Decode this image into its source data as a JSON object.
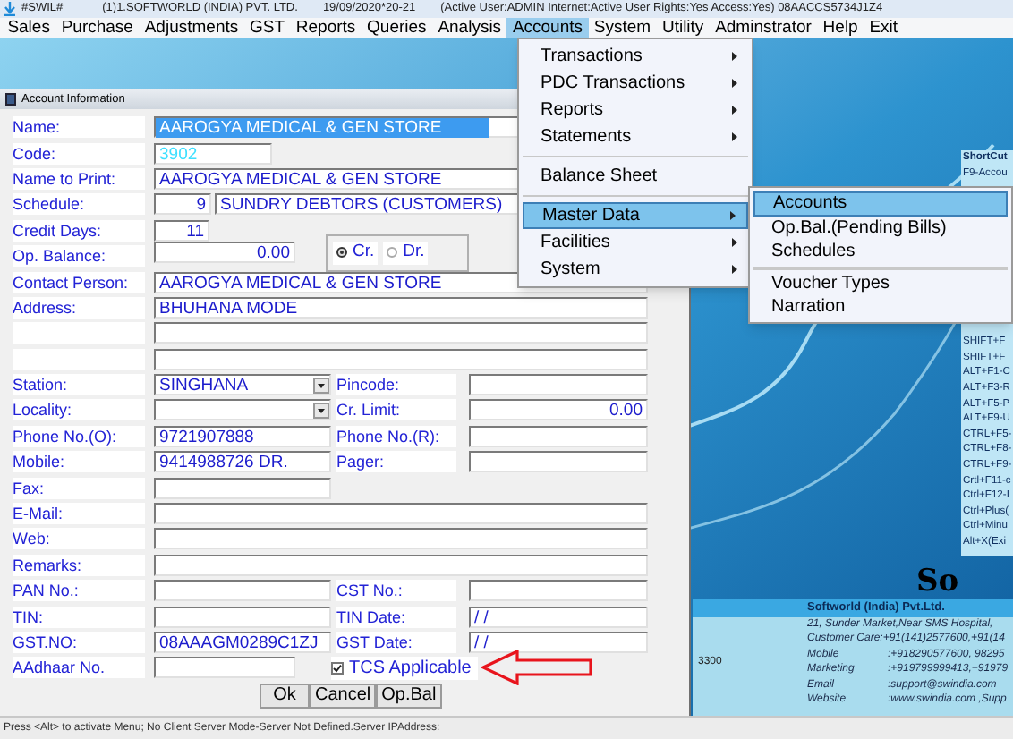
{
  "title_bar": {
    "app": "#SWIL#",
    "company": "(1)1.SOFTWORLD (INDIA) PVT. LTD.",
    "date": "19/09/2020*20-21",
    "session": "(Active User:ADMIN Internet:Active  User Rights:Yes Access:Yes) 08AACCS5734J1Z4"
  },
  "menu_bar": [
    {
      "label": "Sales",
      "selected": false
    },
    {
      "label": "Purchase",
      "selected": false
    },
    {
      "label": "Adjustments",
      "selected": false
    },
    {
      "label": "GST",
      "selected": false
    },
    {
      "label": "Reports",
      "selected": false
    },
    {
      "label": "Queries",
      "selected": false
    },
    {
      "label": "Analysis",
      "selected": false
    },
    {
      "label": "Accounts",
      "selected": true
    },
    {
      "label": "System",
      "selected": false
    },
    {
      "label": "Utility",
      "selected": false
    },
    {
      "label": "Adminstrator",
      "selected": false
    },
    {
      "label": "Help",
      "selected": false
    },
    {
      "label": "Exit",
      "selected": false
    }
  ],
  "accounts_menu": [
    {
      "label": "Transactions",
      "submenu": true,
      "separator_before": false,
      "selected": false
    },
    {
      "label": "PDC Transactions",
      "submenu": true,
      "separator_before": false,
      "selected": false
    },
    {
      "label": "Reports",
      "submenu": true,
      "separator_before": false,
      "selected": false
    },
    {
      "label": "Statements",
      "submenu": true,
      "separator_before": false,
      "selected": false
    },
    {
      "label": "Balance Sheet",
      "submenu": false,
      "separator_before": true,
      "selected": false
    },
    {
      "label": "Master Data",
      "submenu": true,
      "separator_before": true,
      "selected": true
    },
    {
      "label": "Facilities",
      "submenu": true,
      "separator_before": false,
      "selected": false
    },
    {
      "label": "System",
      "submenu": true,
      "separator_before": false,
      "selected": false
    }
  ],
  "master_data_submenu": [
    {
      "label": "Accounts",
      "separator_before": false,
      "selected": true
    },
    {
      "label": "Op.Bal.(Pending Bills)",
      "separator_before": false,
      "selected": false
    },
    {
      "label": "Schedules",
      "separator_before": false,
      "selected": false
    },
    {
      "label": "Voucher Types",
      "separator_before": true,
      "selected": false
    },
    {
      "label": "Narration",
      "separator_before": false,
      "selected": false
    }
  ],
  "account_form": {
    "title": "Account Information",
    "rows": [
      {
        "kind": "selected_text",
        "label": "Name:",
        "value": "AAROGYA MEDICAL & GEN STORE"
      },
      {
        "kind": "code",
        "label": "Code:",
        "value": "3902"
      },
      {
        "kind": "wide",
        "label": "Name to Print:",
        "value": "AAROGYA MEDICAL & GEN STORE"
      },
      {
        "kind": "schedule",
        "label": "Schedule:",
        "number": "9",
        "value": "SUNDRY DEBTORS (CUSTOMERS)"
      },
      {
        "kind": "number",
        "label": "Credit Days:",
        "value": "11"
      },
      {
        "kind": "balance",
        "label": "Op. Balance:",
        "value": "0.00",
        "options": [
          {
            "label": "Cr.",
            "selected": true
          },
          {
            "label": "Dr.",
            "selected": false
          }
        ]
      },
      {
        "kind": "wide",
        "label": "Contact Person:",
        "value": "AAROGYA MEDICAL & GEN STORE"
      },
      {
        "kind": "wide",
        "label": "Address:",
        "value": "BHUHANA MODE"
      },
      {
        "kind": "wide"
      },
      {
        "kind": "wide"
      },
      {
        "kind": "split",
        "label": "Station:",
        "dropdown": true,
        "value": "SINGHANA",
        "right": {
          "label": "Pincode:",
          "kind": "text"
        }
      },
      {
        "kind": "split",
        "label": "Locality:",
        "dropdown": true,
        "right": {
          "label": "Cr. Limit:",
          "kind": "number",
          "value": "0.00"
        }
      },
      {
        "kind": "split",
        "label": "Phone No.(O):",
        "dropdown": false,
        "value": "9721907888",
        "right": {
          "label": "Phone No.(R):",
          "kind": "text"
        }
      },
      {
        "kind": "split",
        "label": "Mobile:",
        "dropdown": false,
        "value": "9414988726 DR.",
        "right": {
          "label": "Pager:",
          "kind": "text"
        }
      },
      {
        "kind": "half",
        "label": "Fax:"
      },
      {
        "kind": "wide",
        "label": "E-Mail:"
      },
      {
        "kind": "wide",
        "label": "Web:"
      },
      {
        "kind": "wide",
        "label": "Remarks:"
      },
      {
        "kind": "split",
        "label": "PAN No.:",
        "dropdown": false,
        "right": {
          "label": "CST No.:",
          "kind": "text"
        }
      },
      {
        "kind": "split",
        "label": "TIN:",
        "dropdown": false,
        "right": {
          "label": "TIN Date:",
          "kind": "date",
          "value": "/ /"
        }
      },
      {
        "kind": "split",
        "label": "GST.NO:",
        "dropdown": false,
        "value": "08AAAGM0289C1ZJ",
        "right": {
          "label": "GST Date:",
          "kind": "date",
          "value": "/ /"
        }
      },
      {
        "kind": "checkbox",
        "label": "AAdhaar No.",
        "checkbox": {
          "label": "TCS Applicable",
          "checked": true
        }
      }
    ],
    "buttons": [
      "Ok",
      "Cancel",
      "Op.Bal"
    ]
  },
  "shortcuts": {
    "title": "ShortCut",
    "top": [
      "F9-Accou"
    ],
    "items": [
      "SHIFT+F",
      "SHIFT+F",
      "ALT+F1-C",
      "ALT+F3-R",
      "ALT+F5-P",
      "ALT+F9-U",
      "CTRL+F5-",
      "CTRL+F8-",
      "CTRL+F9-",
      "Crtl+F11-c",
      "Ctrl+F12-I",
      "Ctrl+Plus(",
      "Ctrl+Minu",
      "Alt+X(Exi"
    ]
  },
  "logo_text": "So",
  "fragment": "3300",
  "company_info": {
    "name": "Softworld (India) Pvt.Ltd.",
    "lines": [
      {
        "text": "21, Sunder Market,Near SMS Hospital,"
      },
      {
        "text": "Customer Care:+91(141)2577600,+91(14"
      },
      {
        "label": "Mobile",
        "value": ":+918290577600, 98295"
      },
      {
        "label": "Marketing",
        "value": ":+919799999413,+91979"
      },
      {
        "label": "Email",
        "value": ":support@swindia.com"
      },
      {
        "label": "Website",
        "value": ":www.swindia.com ,Supp"
      }
    ]
  },
  "status_bar": "Press <Alt> to activate Menu; No Client Server Mode-Server Not Defined.Server IPAddress:"
}
